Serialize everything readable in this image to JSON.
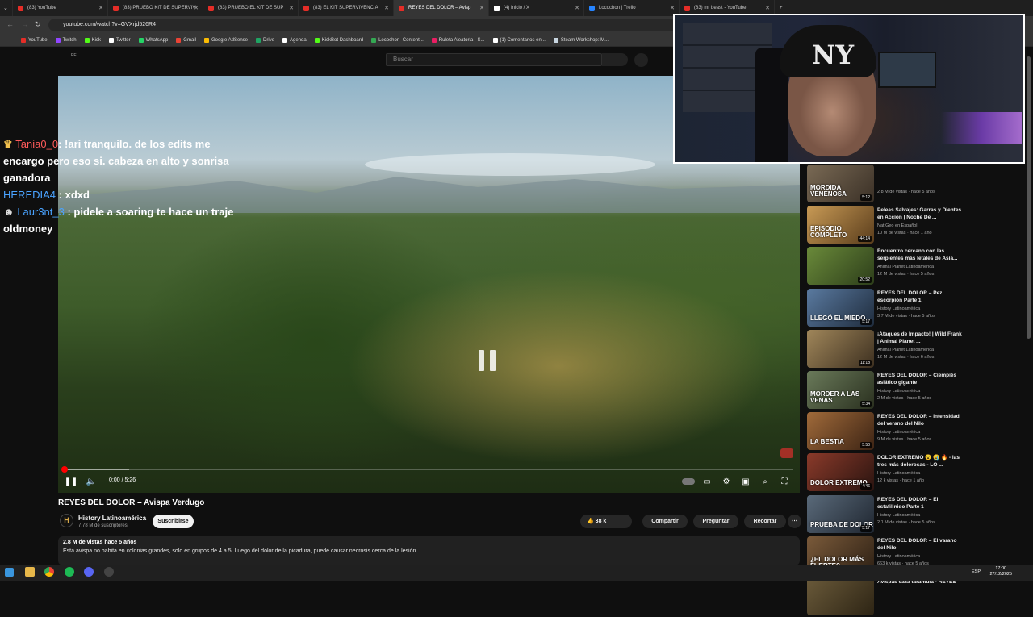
{
  "browser": {
    "tabs": [
      {
        "label": "(83) YouTube",
        "icon": "youtube-icon"
      },
      {
        "label": "(83) PRUEBO KIT DE SUPERVIV",
        "icon": "youtube-icon"
      },
      {
        "label": "(83) PRUEBO EL KIT DE SUP",
        "icon": "youtube-icon"
      },
      {
        "label": "(83) EL KIT SUPERVIVENCIA",
        "icon": "youtube-icon"
      },
      {
        "label": "REYES DEL DOLOR – Avisp",
        "icon": "youtube-icon",
        "active": true
      },
      {
        "label": "(4) Inicio / X",
        "icon": "x-icon"
      },
      {
        "label": "Locochon | Trello",
        "icon": "trello-icon"
      },
      {
        "label": "(83) mr beast - YouTube",
        "icon": "youtube-icon"
      }
    ],
    "url": "youtube.com/watch?v=GVXrjd526R4",
    "bookmarks": [
      {
        "label": "YouTube",
        "color": "#e52d27"
      },
      {
        "label": "Twitch",
        "color": "#9146ff"
      },
      {
        "label": "Kick",
        "color": "#53fc18"
      },
      {
        "label": "Twitter",
        "color": "#ffffff"
      },
      {
        "label": "WhatsApp",
        "color": "#25d366"
      },
      {
        "label": "Gmail",
        "color": "#ea4335"
      },
      {
        "label": "Google AdSense",
        "color": "#fbbc04"
      },
      {
        "label": "Drive",
        "color": "#1fa463"
      },
      {
        "label": "Agenda",
        "color": "#ffffff"
      },
      {
        "label": "KickBot Dashboard",
        "color": "#53fc18"
      },
      {
        "label": "Locochon- Content...",
        "color": "#34a853"
      },
      {
        "label": "Ruleta Aleatoria - S...",
        "color": "#e91e63"
      },
      {
        "label": "(1) Comentarios en...",
        "color": "#ffffff"
      },
      {
        "label": "Steam Workshop::M...",
        "color": "#c7d5e0"
      }
    ]
  },
  "youtube": {
    "search_placeholder": "Buscar",
    "player": {
      "time": "0:00 / 5:26",
      "progress_fraction": 0.0
    },
    "chat_overlay": [
      {
        "user": "Tania0_0",
        "user_color": "#ff5a5a",
        "text": ": !ari tranquilo. de los edits me encargo pero eso si. cabeza en alto y sonrisa ganadora",
        "badge": "crown-icon"
      },
      {
        "user": "HEREDIA4",
        "user_color": "#4aa3ff",
        "text": " : xdxd",
        "badge": ""
      },
      {
        "user": "Laur3nt_3",
        "user_color": "#4aa3ff",
        "text": " : pidele a soaring te hace un traje oldmoney",
        "badge": "mask-icon"
      }
    ],
    "video_title": "REYES DEL DOLOR – Avispa Verdugo",
    "channel": {
      "name": "History Latinoamérica",
      "subscribers": "7.78 M de suscriptores",
      "logo_letter": "H",
      "subscribe_label": "Suscribirse"
    },
    "actions": {
      "likes": "38 k",
      "share": "Compartir",
      "ask": "Preguntar",
      "clip": "Recortar"
    },
    "description": {
      "meta": "2.8 M de vistas  hace 5 años",
      "text": "Esta avispa no habita en colonias grandes, solo en grupos de 4 a 5. Luego del dolor de la picadura, puede causar necrosis cerca de la lesión."
    },
    "recommendations": [
      {
        "title": "",
        "channel": "",
        "meta": "2.8 M de vistas · hace 5 años",
        "duration": "5:12",
        "thumb_text": "MORDIDA VENENOSA",
        "thumb_colors": [
          "#7a6a55",
          "#3a3026"
        ]
      },
      {
        "title": "Peleas Salvajes: Garras y Dientes en Acción | Noche De ...",
        "channel": "Nat Geo en Español",
        "meta": "10 M de vistas · hace 1 año",
        "duration": "44:14",
        "thumb_text": "EPISODIO COMPLETO",
        "thumb_colors": [
          "#c89a55",
          "#5a3d1c"
        ]
      },
      {
        "title": "Encuentro cercano con las serpientes más letales de Asia...",
        "channel": "Animal Planet Latinoamérica",
        "meta": "12 M de vistas · hace 5 años",
        "duration": "20:52",
        "thumb_text": "",
        "thumb_colors": [
          "#6a8a3a",
          "#2d3e1a"
        ]
      },
      {
        "title": "REYES DEL DOLOR – Pez escorpión Parte 1",
        "channel": "History Latinoamérica",
        "meta": "3.7 M de vistas · hace 5 años",
        "duration": "5:17",
        "thumb_text": "LLEGÓ EL MIEDO",
        "thumb_colors": [
          "#5a7aa0",
          "#1f2c3d"
        ]
      },
      {
        "title": "¡Ataques de Impacto! | Wild Frank | Animal Planet ...",
        "channel": "Animal Planet Latinoamérica",
        "meta": "12 M de vistas · hace 6 años",
        "duration": "11:18",
        "thumb_text": "",
        "thumb_colors": [
          "#a0865a",
          "#3d3020"
        ]
      },
      {
        "title": "REYES DEL DOLOR – Ciempiés asiático gigante",
        "channel": "History Latinoamérica",
        "meta": "2 M de vistas · hace 5 años",
        "duration": "5:34",
        "thumb_text": "MORDER A LAS VENAS",
        "thumb_colors": [
          "#6a7a5a",
          "#2a301f"
        ]
      },
      {
        "title": "REYES DEL DOLOR – Intensidad del verano del Nilo",
        "channel": "History Latinoamérica",
        "meta": "9 M de vistas · hace 5 años",
        "duration": "5:50",
        "thumb_text": "LA BESTIA",
        "thumb_colors": [
          "#a06a3a",
          "#3d2414"
        ]
      },
      {
        "title": "DOLOR EXTREMO 😮 😭 🔥 - las tres más dolorosas - LO ...",
        "channel": "History Latinoamérica",
        "meta": "12 k vistas · hace 1 año",
        "duration": "4:46",
        "thumb_text": "DOLOR EXTREMO",
        "thumb_colors": [
          "#8a3a2a",
          "#2a1410"
        ]
      },
      {
        "title": "REYES DEL DOLOR – El estafilinido Parte 1",
        "channel": "History Latinoamérica",
        "meta": "2.1 M de vistas · hace 5 años",
        "duration": "5:17",
        "thumb_text": "PRUEBA DE DOLOR",
        "thumb_colors": [
          "#5a6a7a",
          "#1f2630"
        ]
      },
      {
        "title": "REYES DEL DOLOR – El varano del Nilo",
        "channel": "History Latinoamérica",
        "meta": "663 k vistas · hace 5 años",
        "duration": "5:05",
        "thumb_text": "¿EL DOLOR MÁS FUERTE?",
        "thumb_colors": [
          "#7a5a3a",
          "#2d2014"
        ]
      },
      {
        "title": "Avispas caza tarántula - REYES",
        "channel": "",
        "meta": "",
        "duration": "",
        "thumb_text": "",
        "thumb_colors": [
          "#6a5a3a",
          "#2d2414"
        ]
      }
    ]
  },
  "taskbar": {
    "language": "ESP",
    "time": "17:00",
    "date": "27/12/2025"
  }
}
